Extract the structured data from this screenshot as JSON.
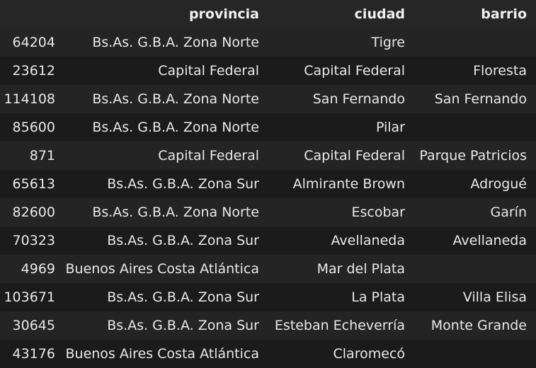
{
  "table": {
    "columns": [
      "",
      "provincia",
      "ciudad",
      "barrio"
    ],
    "rows": [
      {
        "index": "64204",
        "provincia": "Bs.As. G.B.A. Zona Norte",
        "ciudad": "Tigre",
        "barrio": ""
      },
      {
        "index": "23612",
        "provincia": "Capital Federal",
        "ciudad": "Capital Federal",
        "barrio": "Floresta"
      },
      {
        "index": "114108",
        "provincia": "Bs.As. G.B.A. Zona Norte",
        "ciudad": "San Fernando",
        "barrio": "San Fernando"
      },
      {
        "index": "85600",
        "provincia": "Bs.As. G.B.A. Zona Norte",
        "ciudad": "Pilar",
        "barrio": ""
      },
      {
        "index": "871",
        "provincia": "Capital Federal",
        "ciudad": "Capital Federal",
        "barrio": "Parque Patricios"
      },
      {
        "index": "65613",
        "provincia": "Bs.As. G.B.A. Zona Sur",
        "ciudad": "Almirante Brown",
        "barrio": "Adrogué"
      },
      {
        "index": "82600",
        "provincia": "Bs.As. G.B.A. Zona Norte",
        "ciudad": "Escobar",
        "barrio": "Garín"
      },
      {
        "index": "70323",
        "provincia": "Bs.As. G.B.A. Zona Sur",
        "ciudad": "Avellaneda",
        "barrio": "Avellaneda"
      },
      {
        "index": "4969",
        "provincia": "Buenos Aires Costa Atlántica",
        "ciudad": "Mar del Plata",
        "barrio": ""
      },
      {
        "index": "103671",
        "provincia": "Bs.As. G.B.A. Zona Sur",
        "ciudad": "La Plata",
        "barrio": "Villa Elisa"
      },
      {
        "index": "30645",
        "provincia": "Bs.As. G.B.A. Zona Sur",
        "ciudad": "Esteban Echeverría",
        "barrio": "Monte Grande"
      },
      {
        "index": "43176",
        "provincia": "Buenos Aires Costa Atlántica",
        "ciudad": "Claromecó",
        "barrio": ""
      }
    ]
  }
}
